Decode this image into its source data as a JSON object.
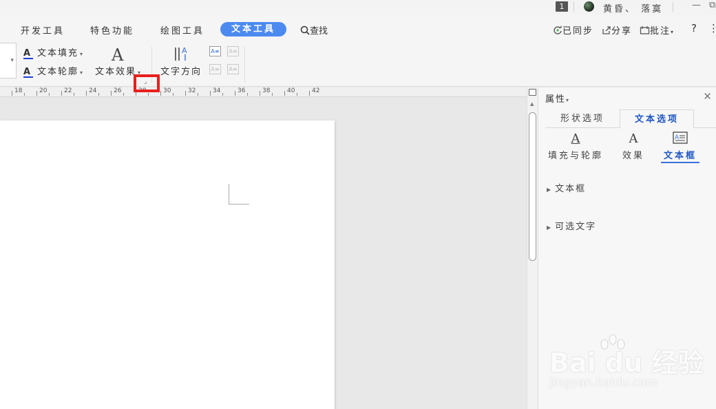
{
  "titlebar": {
    "page_badge": "1",
    "username": "黄昏、 落寞",
    "minimize": "—",
    "restore": "⧉"
  },
  "tabs": [
    {
      "label": "开发工具"
    },
    {
      "label": "特色功能"
    },
    {
      "label": "绘图工具"
    },
    {
      "label": "文本工具",
      "active": true
    }
  ],
  "search": {
    "label": "查找"
  },
  "right_tools": {
    "sync": "已同步",
    "share": "分享",
    "comment": "批注",
    "help": "?",
    "more": "⋮"
  },
  "ribbon": {
    "text_fill": "文本填充",
    "text_outline": "文本轮廓",
    "text_effect": "文本效果",
    "text_direction": "文字方向",
    "icon_glyph": "A",
    "caret": "▾"
  },
  "ruler": {
    "labels": [
      "18",
      "20",
      "22",
      "24",
      "26",
      "28",
      "30",
      "32",
      "34",
      "36",
      "38",
      "40",
      "42"
    ]
  },
  "panel": {
    "title": "属性",
    "close": "✕",
    "tabs": [
      "形状选项",
      "文本选项"
    ],
    "active_tab": 1,
    "subtabs": [
      {
        "label": "填充与轮廓",
        "icon": "A"
      },
      {
        "label": "效果",
        "icon": "A"
      },
      {
        "label": "文本框",
        "icon": "A="
      }
    ],
    "active_subtab": 2,
    "sections": [
      "文本框",
      "可选文字"
    ]
  },
  "watermark": {
    "main": "Bai du 经验",
    "sub": "jingyan.baidu.com"
  },
  "colors": {
    "accent": "#4c8af0",
    "active_text": "#1e56c2",
    "highlight": "#e8201c",
    "underline": "#1d3fd6"
  }
}
